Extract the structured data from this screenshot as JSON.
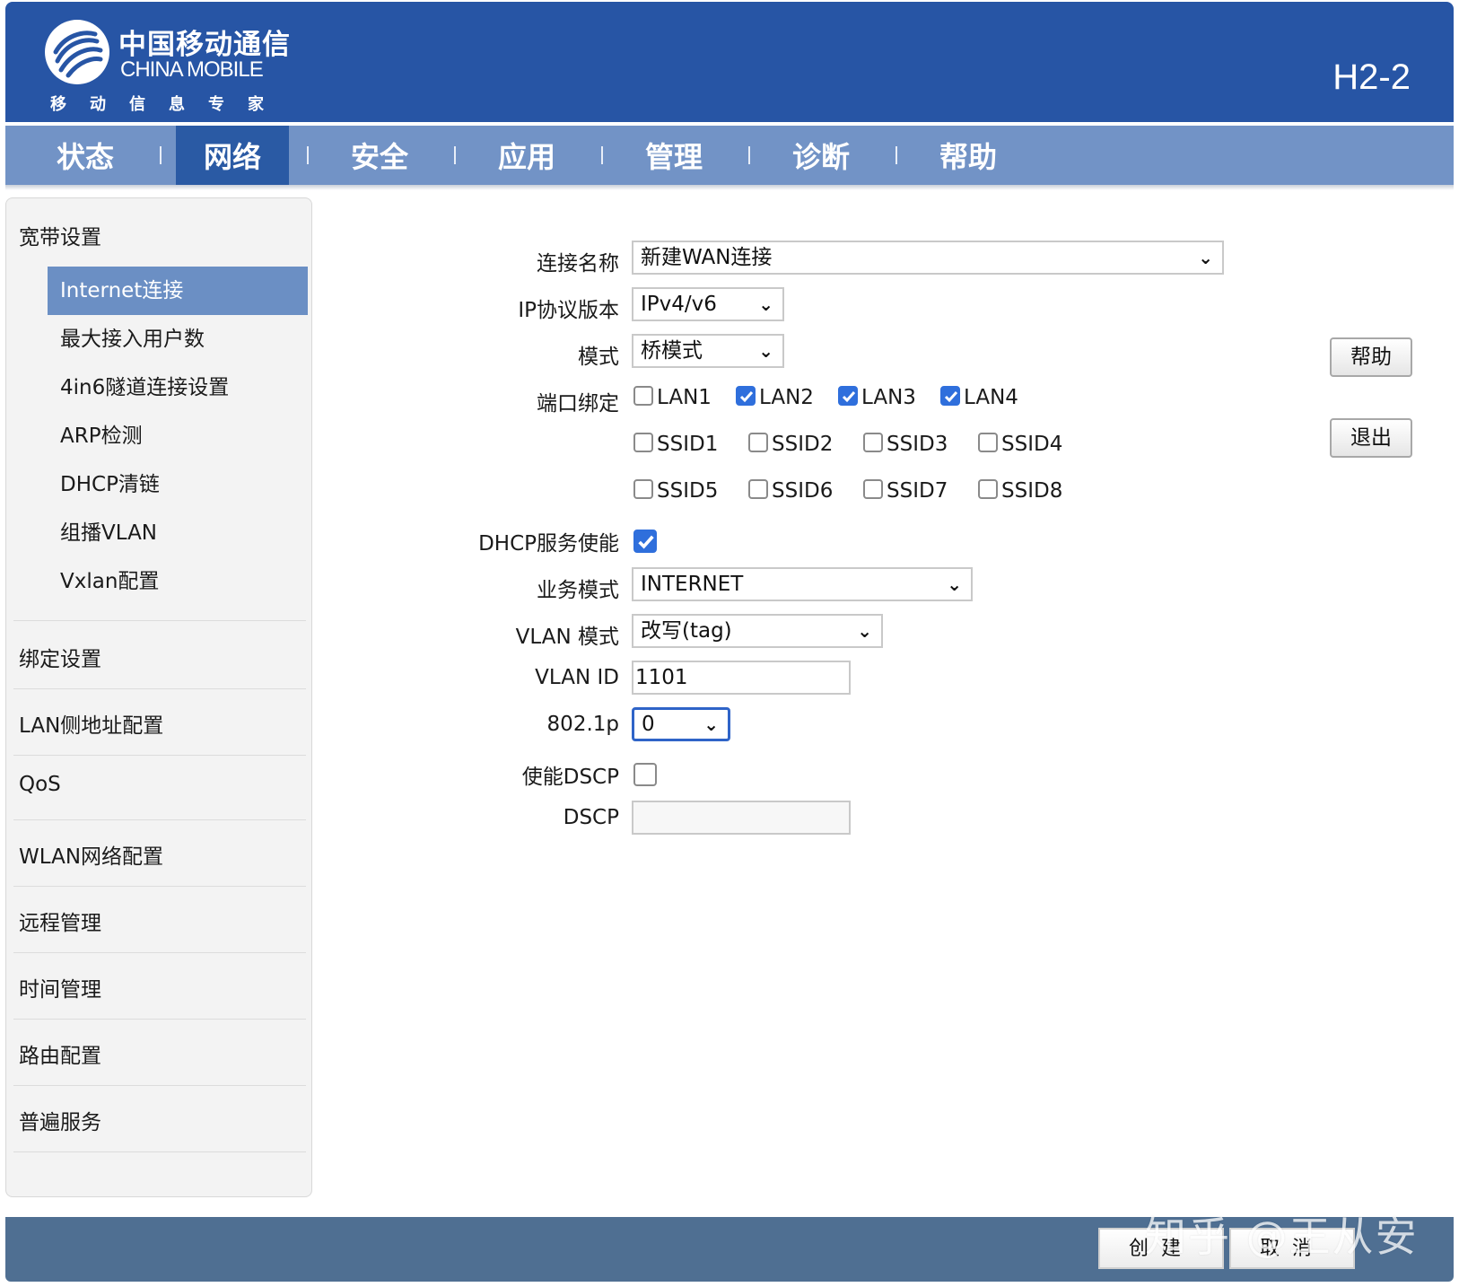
{
  "header": {
    "logo_cn": "中国移动通信",
    "logo_en": "CHINA MOBILE",
    "logo_slogan": "移动信息专家",
    "model": "H2-2",
    "brand_color": "#2755a5"
  },
  "nav": {
    "items": [
      {
        "label": "状态"
      },
      {
        "label": "网络",
        "active": true
      },
      {
        "label": "安全"
      },
      {
        "label": "应用"
      },
      {
        "label": "管理"
      },
      {
        "label": "诊断"
      },
      {
        "label": "帮助"
      }
    ]
  },
  "sidebar": {
    "sections": [
      {
        "label": "宽带设置"
      },
      {
        "label": "绑定设置"
      },
      {
        "label": "LAN侧地址配置"
      },
      {
        "label": "QoS"
      },
      {
        "label": "WLAN网络配置"
      },
      {
        "label": "远程管理"
      },
      {
        "label": "时间管理"
      },
      {
        "label": "路由配置"
      },
      {
        "label": "普遍服务"
      }
    ],
    "sub_items": [
      {
        "label": "Internet连接",
        "active": true
      },
      {
        "label": "最大接入用户数"
      },
      {
        "label": "4in6隧道连接设置"
      },
      {
        "label": "ARP检测"
      },
      {
        "label": "DHCP清链"
      },
      {
        "label": "组播VLAN"
      },
      {
        "label": "Vxlan配置"
      }
    ]
  },
  "form": {
    "connection_name": {
      "label": "连接名称",
      "value": "新建WAN连接"
    },
    "ip_version": {
      "label": "IP协议版本",
      "value": "IPv4/v6"
    },
    "mode": {
      "label": "模式",
      "value": "桥模式"
    },
    "port_binding": {
      "label": "端口绑定",
      "lan": [
        {
          "label": "LAN1",
          "checked": false
        },
        {
          "label": "LAN2",
          "checked": true
        },
        {
          "label": "LAN3",
          "checked": true
        },
        {
          "label": "LAN4",
          "checked": true
        }
      ],
      "ssid": [
        {
          "label": "SSID1",
          "checked": false
        },
        {
          "label": "SSID2",
          "checked": false
        },
        {
          "label": "SSID3",
          "checked": false
        },
        {
          "label": "SSID4",
          "checked": false
        },
        {
          "label": "SSID5",
          "checked": false
        },
        {
          "label": "SSID6",
          "checked": false
        },
        {
          "label": "SSID7",
          "checked": false
        },
        {
          "label": "SSID8",
          "checked": false
        }
      ]
    },
    "dhcp_enable": {
      "label": "DHCP服务使能",
      "checked": true
    },
    "service_mode": {
      "label": "业务模式",
      "value": "INTERNET"
    },
    "vlan_mode": {
      "label": "VLAN 模式",
      "value": "改写(tag)"
    },
    "vlan_id": {
      "label": "VLAN ID",
      "value": "1101"
    },
    "dot1p": {
      "label": "802.1p",
      "value": "0"
    },
    "dscp_enable": {
      "label": "使能DSCP",
      "checked": false
    },
    "dscp": {
      "label": "DSCP",
      "value": ""
    }
  },
  "side_buttons": {
    "help": "帮助",
    "exit": "退出"
  },
  "footer": {
    "create": "创建",
    "cancel": "取消"
  },
  "watermark": "知乎 @王从安"
}
